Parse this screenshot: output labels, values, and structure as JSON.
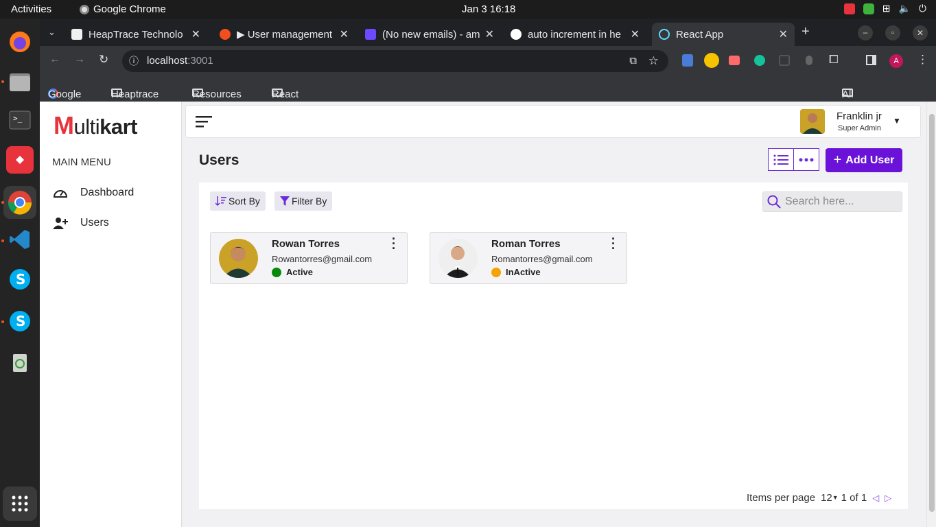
{
  "system": {
    "activities": "Activities",
    "app_name": "Google Chrome",
    "clock": "Jan 3  16:18"
  },
  "browser": {
    "tabs": [
      {
        "label": "HeapTrace Technolo",
        "favicon_color": "#f0f0f0"
      },
      {
        "label": "▶ User management",
        "favicon_color": "#f24e1e"
      },
      {
        "label": "(No new emails) - am",
        "favicon_color": "#6d4aff"
      },
      {
        "label": "auto increment in he",
        "favicon_color": "#ffffff"
      },
      {
        "label": "React App",
        "favicon_color": "#61dafb"
      }
    ],
    "url_host": "localhost",
    "url_port": ":3001",
    "bookmarks": [
      "Google",
      "Heaptrace",
      "Resources",
      "React"
    ],
    "all_bookmarks": "All Bookmarks"
  },
  "sidebar": {
    "logo_m": "M",
    "logo_rest": "ulti",
    "logo_bold": "kart",
    "menu_heading": "MAIN MENU",
    "items": [
      {
        "label": "Dashboard",
        "icon": "gauge-icon"
      },
      {
        "label": "Users",
        "icon": "user-plus-icon"
      }
    ]
  },
  "header": {
    "user_name": "Franklin jr",
    "user_role": "Super Admin"
  },
  "main": {
    "title": "Users",
    "add_button": "Add User",
    "sort_label": "Sort By",
    "filter_label": "Filter By",
    "search_placeholder": "Search here...",
    "users": [
      {
        "name": "Rowan Torres",
        "email": "Rowantorres@gmail.com",
        "status": "Active",
        "status_color": "#0a8a0a"
      },
      {
        "name": "Roman Torres",
        "email": "Romantorres@gmail.com",
        "status": "InActive",
        "status_color": "#f5a300"
      }
    ],
    "pager": {
      "label": "Items per page",
      "per_page": "12",
      "range": "1 of 1"
    }
  },
  "colors": {
    "accent": "#6a12d8",
    "logo_red": "#e8333d"
  }
}
